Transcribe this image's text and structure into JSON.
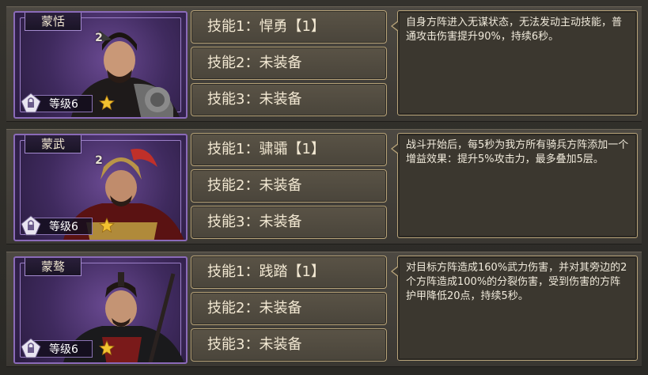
{
  "heroes": [
    {
      "name": "蒙恬",
      "level": "等级6",
      "badge": "2",
      "skills": [
        "技能1：悍勇【1】",
        "技能2：未装备",
        "技能3：未装备"
      ],
      "description": "自身方阵进入无谋状态，无法发动主动技能，普通攻击伤害提升90%，持续6秒。"
    },
    {
      "name": "蒙武",
      "level": "等级6",
      "badge": "2",
      "skills": [
        "技能1：骕骦【1】",
        "技能2：未装备",
        "技能3：未装备"
      ],
      "description": "战斗开始后，每5秒为我方所有骑兵方阵添加一个增益效果：提升5%攻击力，最多叠加5层。"
    },
    {
      "name": "蒙骜",
      "level": "等级6",
      "badge": "",
      "skills": [
        "技能1：践踏【1】",
        "技能2：未装备",
        "技能3：未装备"
      ],
      "description": "对目标方阵造成160%武力伤害，并对其旁边的2个方阵造成100%的分裂伤害，受到伤害的方阵护甲降低20点，持续5秒。"
    }
  ],
  "icons": {
    "lock": "padlock-icon",
    "star": "star-icon"
  },
  "colors": {
    "portrait_frame": "#8a6ab8",
    "skill_border": "#b8a47a",
    "star": "#f2c230"
  }
}
